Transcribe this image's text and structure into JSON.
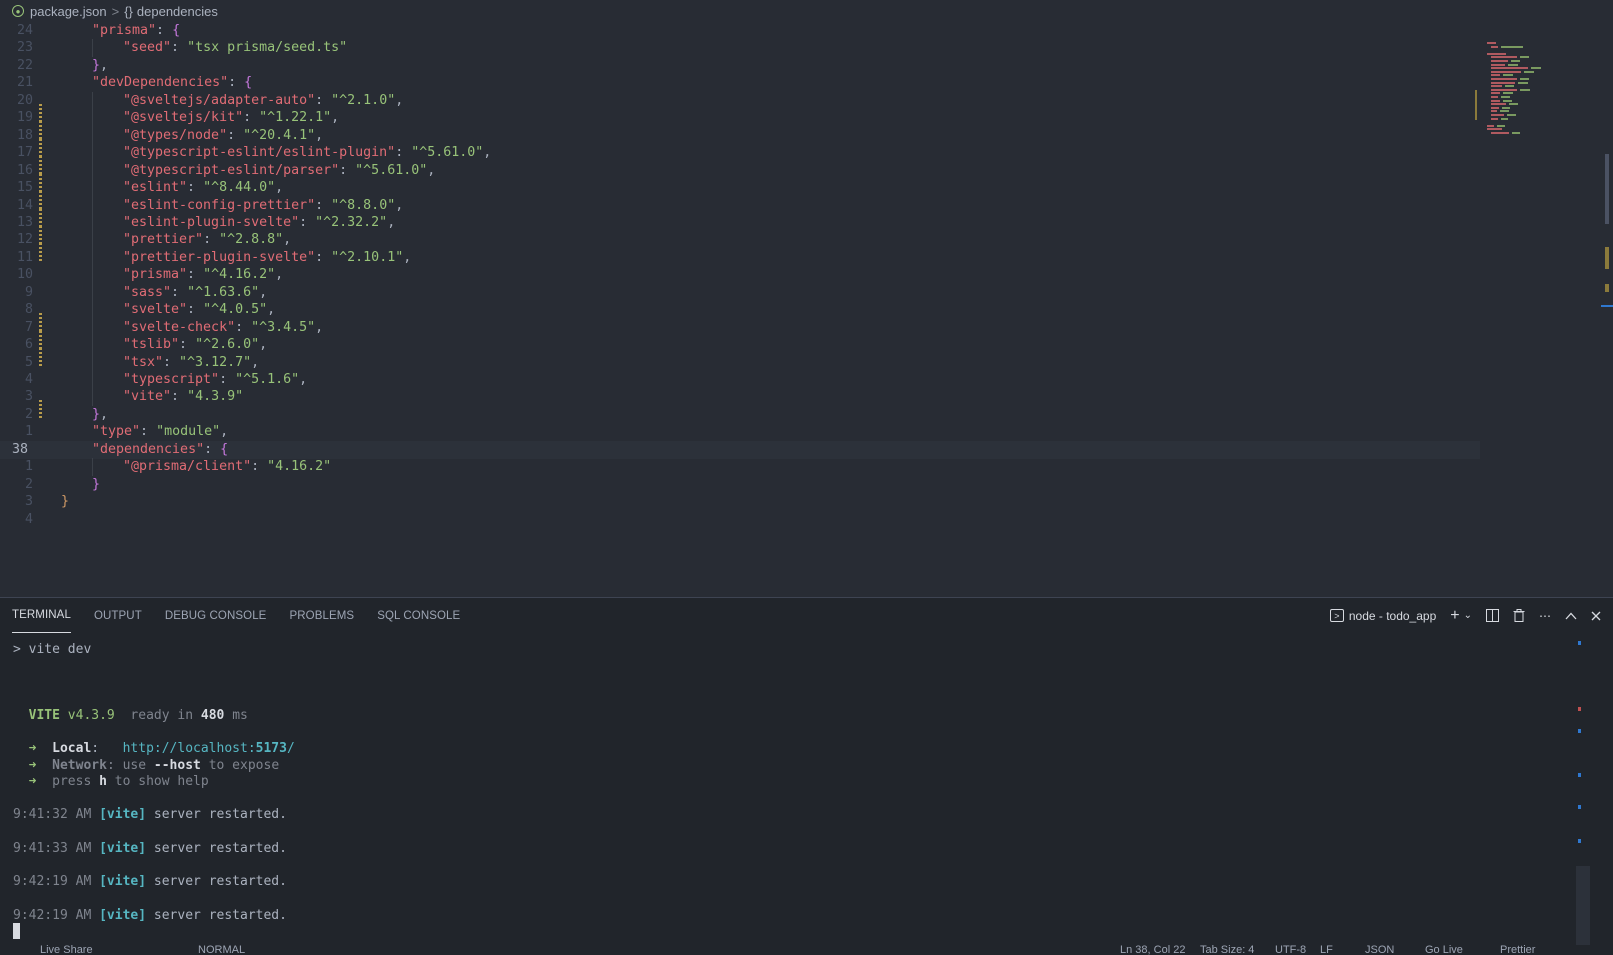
{
  "breadcrumb": {
    "file": "package.json",
    "separator": ">",
    "braces": "{}",
    "symbol": "dependencies"
  },
  "editor": {
    "current_line_number": "38",
    "lines": [
      {
        "ln": "24",
        "indent": 1,
        "key": "\"prisma\"",
        "sep": ": ",
        "value": "",
        "open": "{",
        "ob": "b2",
        "close": "",
        "tail": "",
        "mod": false
      },
      {
        "ln": "23",
        "indent": 2,
        "key": "\"seed\"",
        "sep": ": ",
        "value": "\"tsx prisma/seed.ts\"",
        "open": "",
        "close": "",
        "tail": "",
        "mod": false
      },
      {
        "ln": "22",
        "indent": 1,
        "key": "",
        "sep": "",
        "value": "",
        "open": "",
        "close": "}",
        "cb": "b2",
        "tail": ",",
        "mod": false
      },
      {
        "ln": "21",
        "indent": 1,
        "key": "\"devDependencies\"",
        "sep": ": ",
        "value": "",
        "open": "{",
        "ob": "b2",
        "close": "",
        "tail": "",
        "mod": false
      },
      {
        "ln": "20",
        "indent": 2,
        "key": "\"@sveltejs/adapter-auto\"",
        "sep": ": ",
        "value": "\"^2.1.0\"",
        "tail": ",",
        "mod": true
      },
      {
        "ln": "19",
        "indent": 2,
        "key": "\"@sveltejs/kit\"",
        "sep": ": ",
        "value": "\"^1.22.1\"",
        "tail": ",",
        "mod": true
      },
      {
        "ln": "18",
        "indent": 2,
        "key": "\"@types/node\"",
        "sep": ": ",
        "value": "\"^20.4.1\"",
        "tail": ",",
        "mod": true
      },
      {
        "ln": "17",
        "indent": 2,
        "key": "\"@typescript-eslint/eslint-plugin\"",
        "sep": ": ",
        "value": "\"^5.61.0\"",
        "tail": ",",
        "mod": true
      },
      {
        "ln": "16",
        "indent": 2,
        "key": "\"@typescript-eslint/parser\"",
        "sep": ": ",
        "value": "\"^5.61.0\"",
        "tail": ",",
        "mod": true
      },
      {
        "ln": "15",
        "indent": 2,
        "key": "\"eslint\"",
        "sep": ": ",
        "value": "\"^8.44.0\"",
        "tail": ",",
        "mod": true
      },
      {
        "ln": "14",
        "indent": 2,
        "key": "\"eslint-config-prettier\"",
        "sep": ": ",
        "value": "\"^8.8.0\"",
        "tail": ",",
        "mod": true
      },
      {
        "ln": "13",
        "indent": 2,
        "key": "\"eslint-plugin-svelte\"",
        "sep": ": ",
        "value": "\"^2.32.2\"",
        "tail": ",",
        "mod": true
      },
      {
        "ln": "12",
        "indent": 2,
        "key": "\"prettier\"",
        "sep": ": ",
        "value": "\"^2.8.8\"",
        "tail": ",",
        "mod": true
      },
      {
        "ln": "11",
        "indent": 2,
        "key": "\"prettier-plugin-svelte\"",
        "sep": ": ",
        "value": "\"^2.10.1\"",
        "tail": ",",
        "mod": false
      },
      {
        "ln": "10",
        "indent": 2,
        "key": "\"prisma\"",
        "sep": ": ",
        "value": "\"^4.16.2\"",
        "tail": ",",
        "mod": false
      },
      {
        "ln": "9",
        "indent": 2,
        "key": "\"sass\"",
        "sep": ": ",
        "value": "\"^1.63.6\"",
        "tail": ",",
        "mod": false
      },
      {
        "ln": "8",
        "indent": 2,
        "key": "\"svelte\"",
        "sep": ": ",
        "value": "\"^4.0.5\"",
        "tail": ",",
        "mod": true
      },
      {
        "ln": "7",
        "indent": 2,
        "key": "\"svelte-check\"",
        "sep": ": ",
        "value": "\"^3.4.5\"",
        "tail": ",",
        "mod": true
      },
      {
        "ln": "6",
        "indent": 2,
        "key": "\"tslib\"",
        "sep": ": ",
        "value": "\"^2.6.0\"",
        "tail": ",",
        "mod": true
      },
      {
        "ln": "5",
        "indent": 2,
        "key": "\"tsx\"",
        "sep": ": ",
        "value": "\"^3.12.7\"",
        "tail": ",",
        "mod": false
      },
      {
        "ln": "4",
        "indent": 2,
        "key": "\"typescript\"",
        "sep": ": ",
        "value": "\"^5.1.6\"",
        "tail": ",",
        "mod": false
      },
      {
        "ln": "3",
        "indent": 2,
        "key": "\"vite\"",
        "sep": ": ",
        "value": "\"4.3.9\"",
        "tail": "",
        "mod": true
      },
      {
        "ln": "2",
        "indent": 1,
        "key": "",
        "sep": "",
        "value": "",
        "open": "",
        "close": "}",
        "cb": "b2",
        "tail": ",",
        "mod": false
      },
      {
        "ln": "1",
        "indent": 1,
        "key": "\"type\"",
        "sep": ": ",
        "value": "\"module\"",
        "tail": ",",
        "mod": false
      },
      {
        "ln": "38",
        "indent": 1,
        "key": "\"dependencies\"",
        "sep": ": ",
        "value": "",
        "open": "{",
        "ob": "b2",
        "close": "",
        "tail": "",
        "mod": false,
        "current": true
      },
      {
        "ln": "1",
        "indent": 2,
        "key": "\"@prisma/client\"",
        "sep": ": ",
        "value": "\"4.16.2\"",
        "tail": "",
        "mod": false
      },
      {
        "ln": "2",
        "indent": 1,
        "key": "",
        "sep": "",
        "value": "",
        "open": "",
        "close": "}",
        "cb": "b2",
        "tail": "",
        "mod": false
      },
      {
        "ln": "3",
        "indent": 0,
        "key": "",
        "sep": "",
        "value": "",
        "open": "",
        "close": "}",
        "cb": "b1",
        "tail": "",
        "mod": false
      },
      {
        "ln": "4",
        "indent": 0,
        "key": "",
        "sep": "",
        "value": "",
        "open": "",
        "close": "",
        "tail": "",
        "mod": false
      }
    ]
  },
  "panel": {
    "tabs": [
      {
        "label": "TERMINAL",
        "active": true,
        "name": "tab-terminal"
      },
      {
        "label": "OUTPUT",
        "active": false,
        "name": "tab-output"
      },
      {
        "label": "DEBUG CONSOLE",
        "active": false,
        "name": "tab-debug-console"
      },
      {
        "label": "PROBLEMS",
        "active": false,
        "name": "tab-problems"
      },
      {
        "label": "SQL CONSOLE",
        "active": false,
        "name": "tab-sql-console"
      }
    ],
    "terminal_name": "node - todo_app",
    "icons": {
      "terminal": "terminal-icon",
      "add": "plus-icon",
      "dropdown": "chevron-down-icon",
      "split": "split-terminal-icon",
      "kill": "trash-icon",
      "more": "ellipsis-icon",
      "maximize": "chevron-up-icon",
      "close": "close-icon"
    }
  },
  "terminal": {
    "command": "> vite dev",
    "vite_name": "VITE",
    "vite_version": "v4.3.9",
    "ready_text": "ready in",
    "ready_ms": "480",
    "ready_unit": "ms",
    "arrow": "➜",
    "local_label": "Local",
    "local_url_prefix": "http://localhost:",
    "local_url_port": "5173",
    "local_url_suffix": "/",
    "network_label": "Network",
    "network_text_1": "use",
    "network_flag": "--host",
    "network_text_2": "to expose",
    "help_text_1": "press",
    "help_key": "h",
    "help_text_2": "to show help",
    "restarts": [
      {
        "time": "9:41:32 AM",
        "tag": "[vite]",
        "msg": "server restarted."
      },
      {
        "time": "9:41:33 AM",
        "tag": "[vite]",
        "msg": "server restarted."
      },
      {
        "time": "9:42:19 AM",
        "tag": "[vite]",
        "msg": "server restarted."
      },
      {
        "time": "9:42:19 AM",
        "tag": "[vite]",
        "msg": "server restarted."
      }
    ]
  },
  "statusbar": {
    "left_1": "Live Share",
    "mode": "NORMAL",
    "position": "Ln 38, Col 22",
    "tab_size": "Tab Size: 4",
    "encoding": "UTF-8",
    "eol": "LF",
    "language": "JSON",
    "golive": "Go Live",
    "prettier": "Prettier"
  },
  "colors": {
    "editor_bg": "#282c34",
    "panel_bg": "#21252b",
    "key": "#e06c75",
    "string": "#98c379",
    "bracket_outer": "#d19a66",
    "bracket_inner": "#c678dd",
    "vite_tag": "#56b6c2"
  }
}
